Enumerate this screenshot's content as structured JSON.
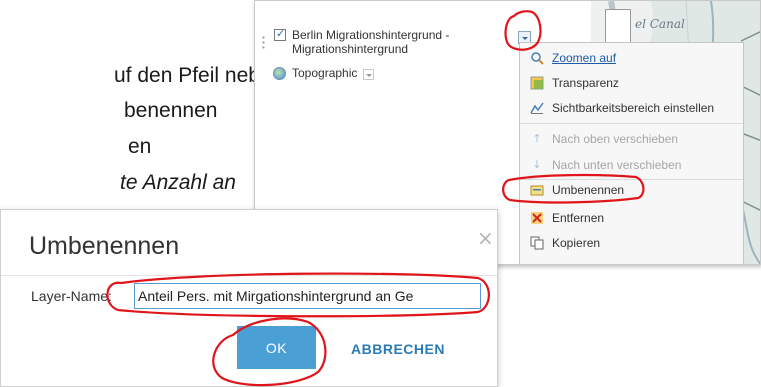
{
  "slide": {
    "lines": [
      "uf den Pfeil neben",
      "benennen",
      "en",
      "te Anzahl an"
    ]
  },
  "layer_panel": {
    "layers": [
      {
        "label_line1": "Berlin Migrationshintergrund -",
        "label_line2": "Migrationshintergrund",
        "checked": true
      },
      {
        "label": "Topographic"
      }
    ],
    "map_label": "el Canal"
  },
  "context_menu": {
    "items": [
      {
        "label": "Zoomen auf",
        "icon": "magnifier-icon",
        "state": "link"
      },
      {
        "label": "Transparenz",
        "icon": "transparency-icon",
        "state": "normal"
      },
      {
        "label": "Sichtbarkeitsbereich einstellen",
        "icon": "visibility-range-icon",
        "state": "normal"
      },
      {
        "label": "Nach oben verschieben",
        "icon": "arrow-up-icon",
        "state": "disabled"
      },
      {
        "label": "Nach unten verschieben",
        "icon": "arrow-down-icon",
        "state": "disabled"
      },
      {
        "label": "Umbenennen",
        "icon": "rename-icon",
        "state": "normal"
      },
      {
        "label": "Entfernen",
        "icon": "remove-icon",
        "state": "normal"
      },
      {
        "label": "Kopieren",
        "icon": "copy-icon",
        "state": "normal"
      }
    ]
  },
  "dialog": {
    "title": "Umbenennen",
    "close_glyph": "×",
    "field_label": "Layer-Name:",
    "field_value": "Anteil Pers. mit Mirgationshintergrund an Ge",
    "ok_label": "OK",
    "cancel_label": "ABBRECHEN"
  },
  "colors": {
    "accent": "#4a9fd5",
    "link": "#1d5aa8",
    "annotation": "#e0151b"
  }
}
